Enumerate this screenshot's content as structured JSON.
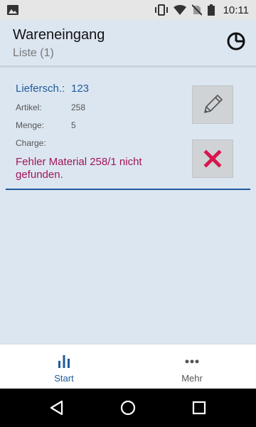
{
  "status_bar": {
    "time": "10:11",
    "icons": [
      "image-icon",
      "vibrate-icon",
      "wifi-icon",
      "no-sim-icon",
      "battery-icon"
    ]
  },
  "header": {
    "title": "Wareneingang",
    "subtitle": "Liste (1)",
    "icon": "pie-chart-icon"
  },
  "item": {
    "lieferschein_label": "Liefersch.:",
    "lieferschein_value": "123",
    "artikel_label": "Artikel:",
    "artikel_value": "258",
    "menge_label": "Menge:",
    "menge_value": "5",
    "charge_label": "Charge:",
    "charge_value": "",
    "error": "Fehler Material 258/1 nicht gefunden.",
    "edit_icon": "pencil-icon",
    "delete_icon": "close-icon"
  },
  "bottom_nav": {
    "items": [
      {
        "label": "Start",
        "icon": "bar-chart-icon",
        "active": true
      },
      {
        "label": "Mehr",
        "icon": "more-dots-icon",
        "active": false
      }
    ]
  },
  "system_nav": {
    "buttons": [
      "back-icon",
      "home-icon",
      "recents-icon"
    ]
  },
  "colors": {
    "accent": "#1f5a99",
    "error": "#a0155a",
    "delete": "#d6174e",
    "background": "#dce6f1"
  }
}
